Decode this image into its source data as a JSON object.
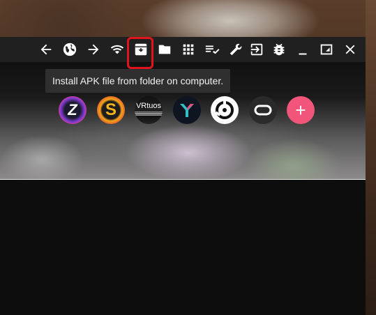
{
  "toolbar": {
    "buttons": [
      {
        "name": "back-button",
        "icon": "arrow-left-icon"
      },
      {
        "name": "browser-button",
        "icon": "globe-icon"
      },
      {
        "name": "forward-button",
        "icon": "arrow-right-icon"
      },
      {
        "name": "wifi-button",
        "icon": "wifi-icon"
      },
      {
        "name": "install-apk-button",
        "icon": "archive-download-icon"
      },
      {
        "name": "folder-button",
        "icon": "folder-icon"
      },
      {
        "name": "apps-grid-button",
        "icon": "grid-icon"
      },
      {
        "name": "playlist-check-button",
        "icon": "playlist-check-icon"
      },
      {
        "name": "tools-button",
        "icon": "wrench-icon"
      },
      {
        "name": "exit-button",
        "icon": "exit-icon"
      },
      {
        "name": "debug-button",
        "icon": "bug-icon"
      },
      {
        "name": "minimize-button",
        "icon": "minimize-icon"
      },
      {
        "name": "resize-button",
        "icon": "resize-icon"
      },
      {
        "name": "close-button",
        "icon": "close-icon"
      }
    ],
    "highlight_color": "#e0141c"
  },
  "tooltip": {
    "text": "Install APK file from folder on computer."
  },
  "apps": [
    {
      "name": "app-icon-z",
      "label": "Z"
    },
    {
      "name": "app-icon-s",
      "label": "S"
    },
    {
      "name": "app-icon-vrtuos",
      "label": "VRtuos"
    },
    {
      "name": "app-icon-y",
      "label": ""
    },
    {
      "name": "app-icon-circle",
      "label": ""
    },
    {
      "name": "app-icon-oculus",
      "label": ""
    },
    {
      "name": "add-app-button",
      "label": "+"
    }
  ],
  "colors": {
    "toolbar_bg": "#202020",
    "add_button": "#f1557a"
  }
}
